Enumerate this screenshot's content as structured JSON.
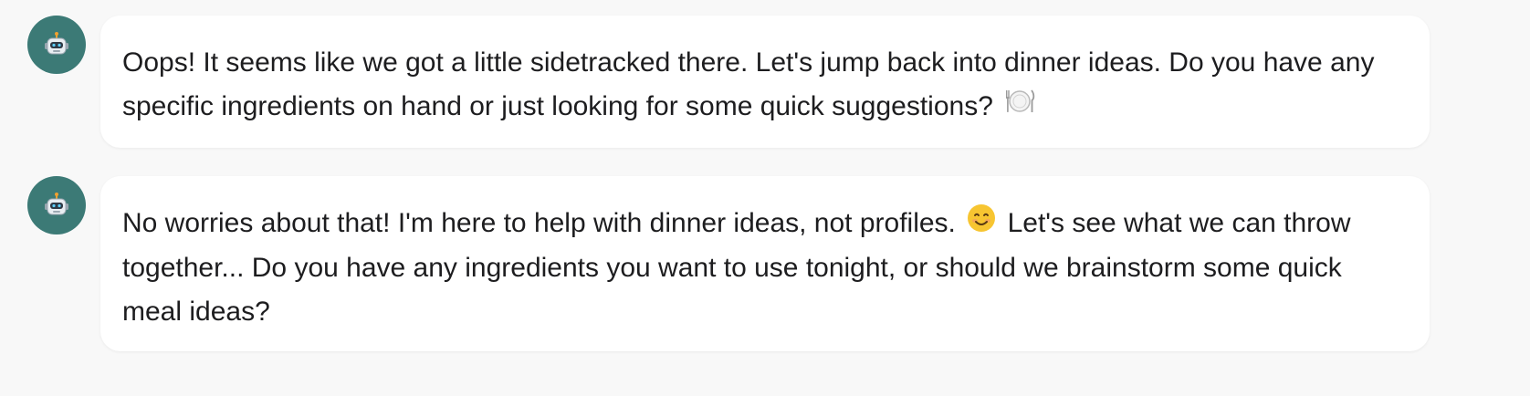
{
  "messages": [
    {
      "avatar_icon": "robot-icon",
      "text_before": "Oops! It seems like we got a little sidetracked there. Let's jump back into dinner ideas. Do you have any specific ingredients on hand or just looking for some quick suggestions?",
      "emoji_1": "plate-with-cutlery-icon",
      "text_after": ""
    },
    {
      "avatar_icon": "robot-icon",
      "text_before": "No worries about that! I'm here to help with dinner ideas, not profiles.",
      "emoji_1": "smiling-face-icon",
      "text_after": "Let's see what we can throw together... Do you have any ingredients you want to use tonight, or should we brainstorm some quick meal ideas?"
    }
  ],
  "colors": {
    "avatar_bg": "#3c7a76",
    "bubble_bg": "#ffffff",
    "page_bg": "#f8f8f8",
    "text": "#1d1d1f"
  }
}
